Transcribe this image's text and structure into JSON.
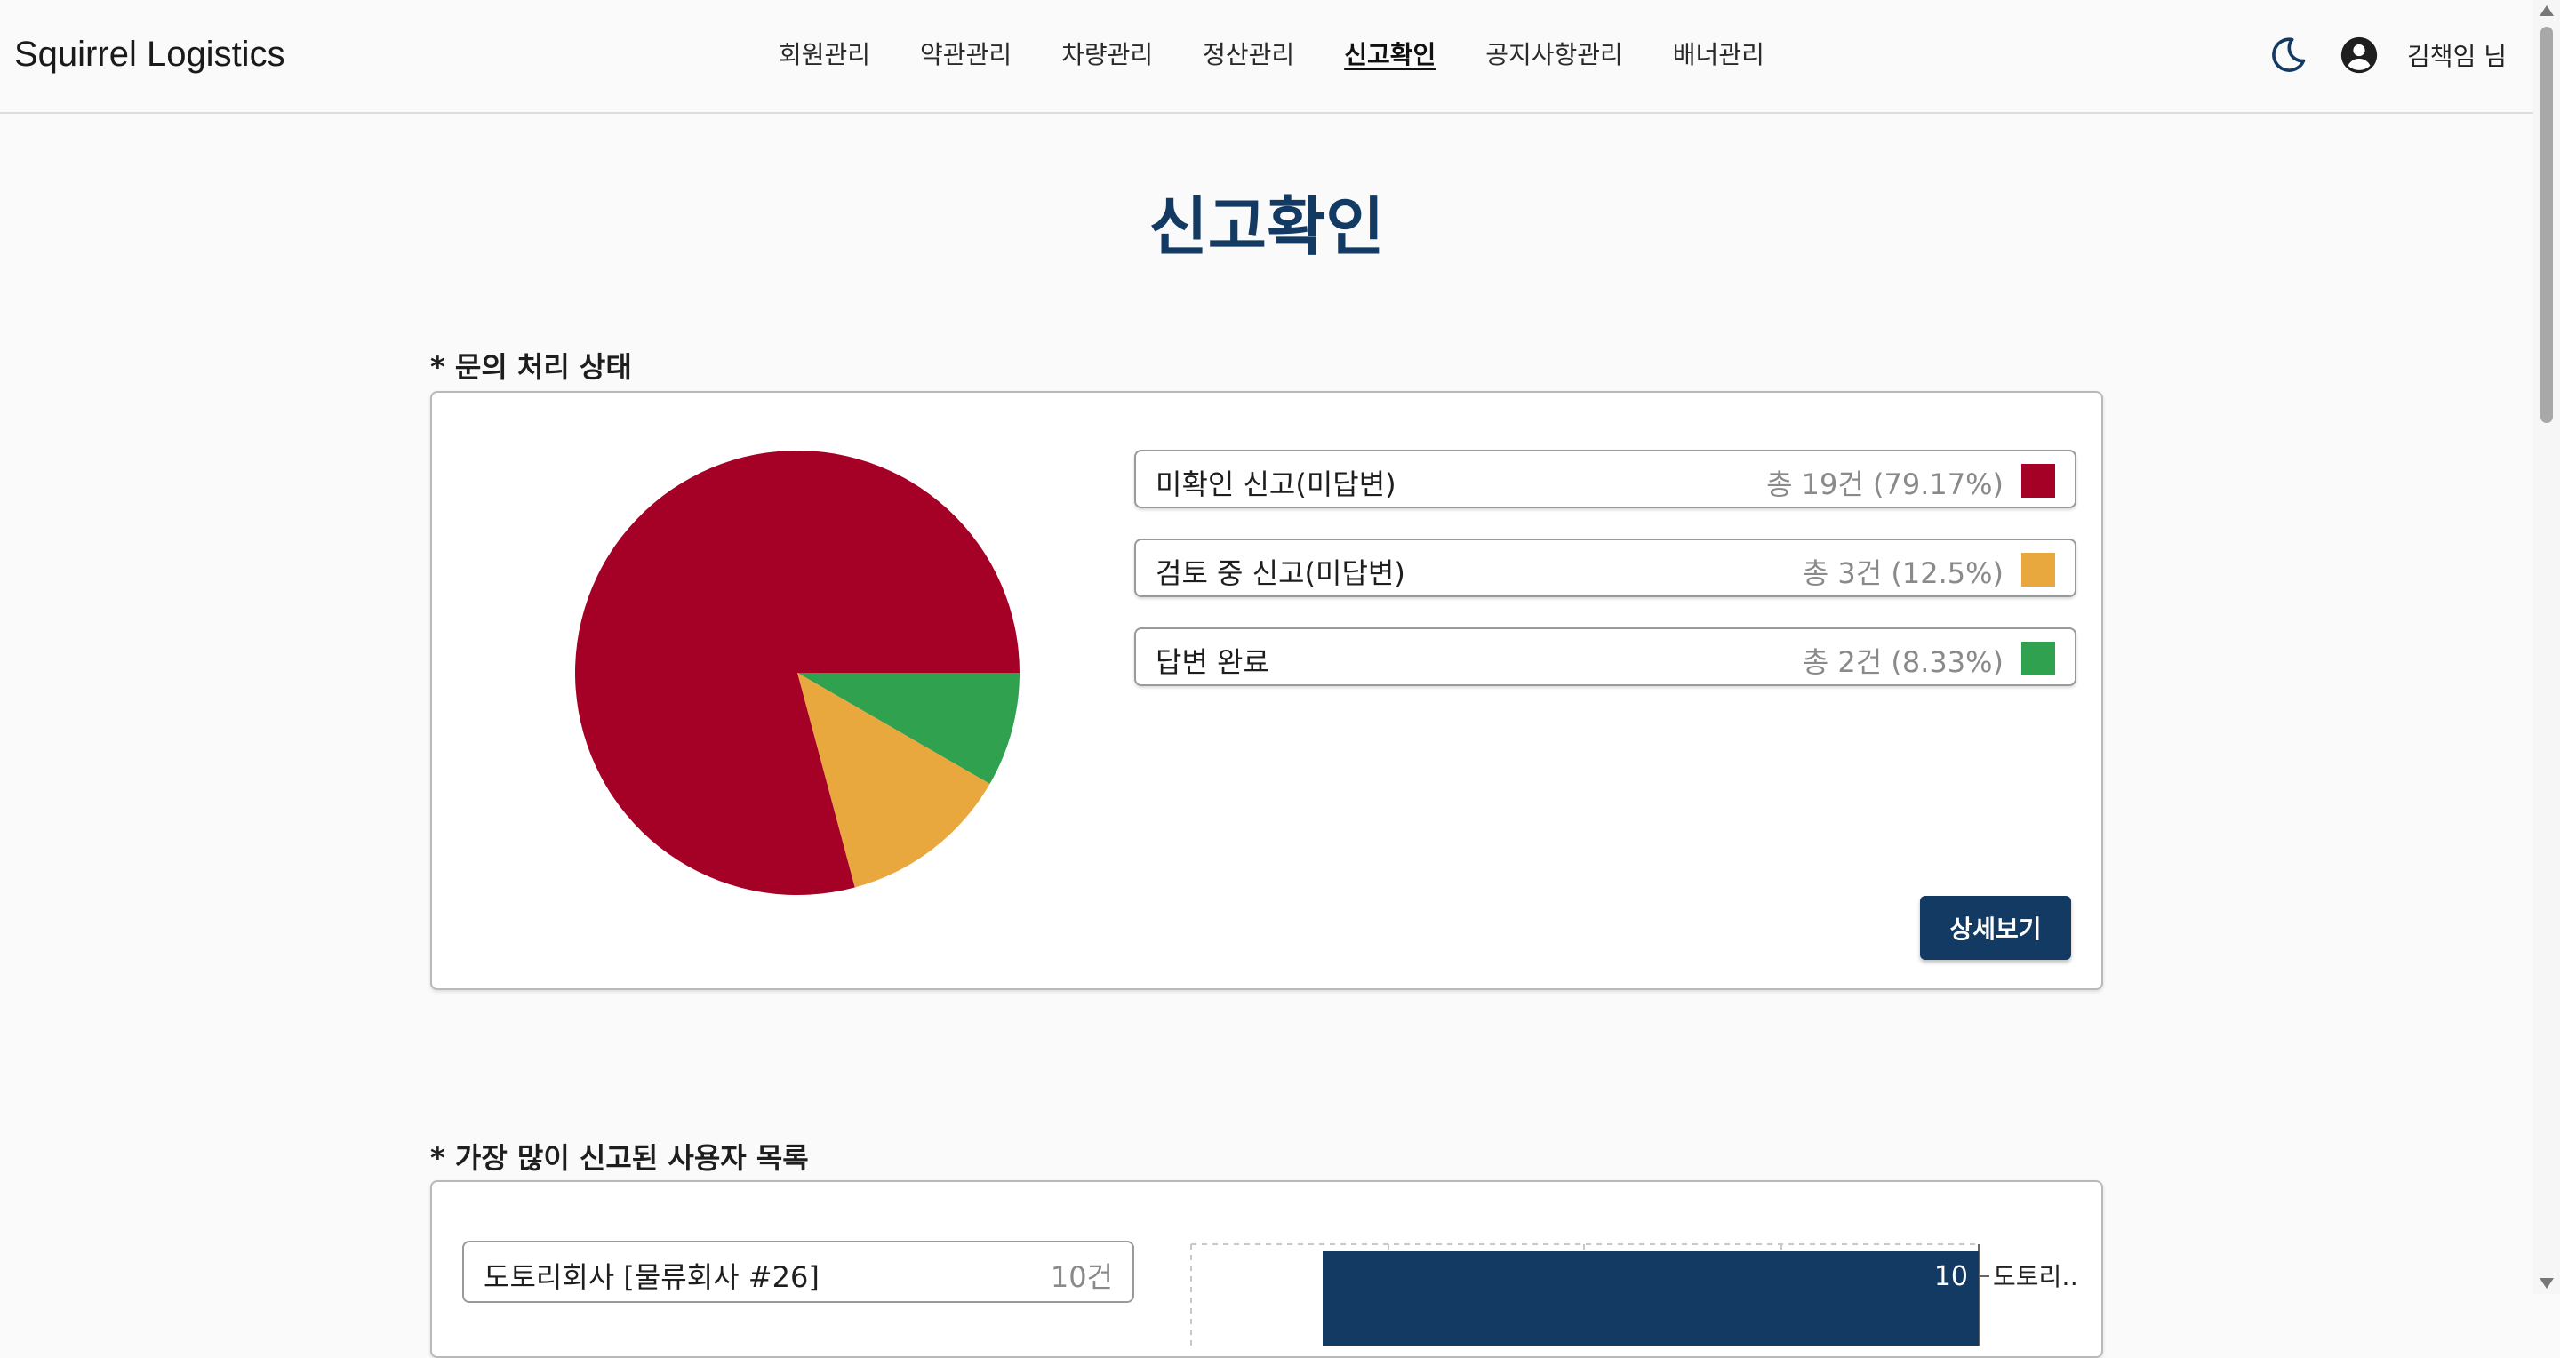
{
  "header": {
    "brand": "Squirrel Logistics",
    "nav": [
      {
        "label": "회원관리",
        "active": false
      },
      {
        "label": "약관관리",
        "active": false
      },
      {
        "label": "차량관리",
        "active": false
      },
      {
        "label": "정산관리",
        "active": false
      },
      {
        "label": "신고확인",
        "active": true
      },
      {
        "label": "공지사항관리",
        "active": false
      },
      {
        "label": "배너관리",
        "active": false
      }
    ],
    "theme_icon": "moon-icon",
    "account_icon": "account-circle-icon",
    "user_name": "김책임 님"
  },
  "page": {
    "title": "신고확인"
  },
  "status_section": {
    "label": "* 문의 처리 상태",
    "items": [
      {
        "label": "미확인 신고(미답변)",
        "count": "총 19건 (79.17%)",
        "value": 19,
        "color": "#a50026"
      },
      {
        "label": "검토 중 신고(미답변)",
        "count": "총 3건 (12.5%)",
        "value": 3,
        "color": "#e8a83e"
      },
      {
        "label": "답변 완료",
        "count": "총 2건 (8.33%)",
        "value": 2,
        "color": "#2fa14f"
      }
    ],
    "detail_button": "상세보기"
  },
  "reported_section": {
    "label": "* 가장 많이 신고된 사용자 목록",
    "users": [
      {
        "name": "도토리회사 [물류회사 #26]",
        "count": "10건"
      }
    ]
  },
  "chart_data": [
    {
      "type": "pie",
      "categories": [
        "미확인 신고(미답변)",
        "검토 중 신고(미답변)",
        "답변 완료"
      ],
      "values": [
        19,
        3,
        2
      ],
      "colors": [
        "#a50026",
        "#e8a83e",
        "#2fa14f"
      ]
    },
    {
      "type": "bar",
      "orientation": "horizontal",
      "categories": [
        "도토리…"
      ],
      "values": [
        10
      ],
      "xlim": [
        0,
        10
      ],
      "color": "#123a63",
      "grid": true
    }
  ]
}
